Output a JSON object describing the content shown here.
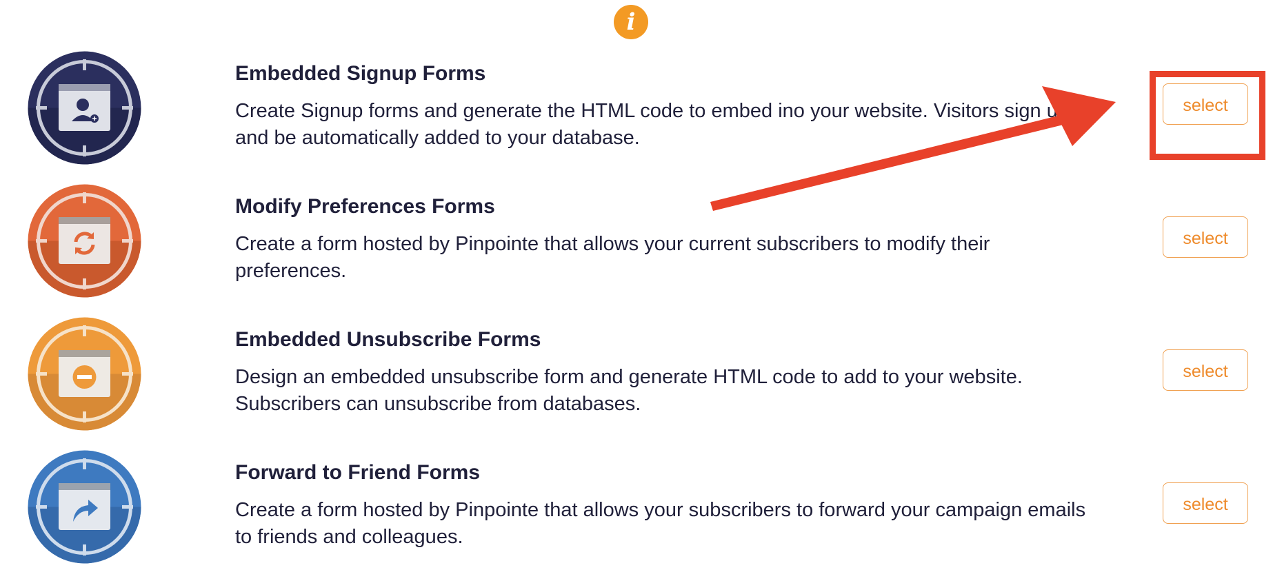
{
  "header": {
    "info_icon": "info-icon"
  },
  "forms": [
    {
      "title": "Embedded Signup Forms",
      "description": "Create Signup forms and generate the HTML code to embed ino your website. Visitors sign up and be automatically added to your database.",
      "icon": "add-user-icon",
      "color": "#2b2f5e",
      "button_label": "select"
    },
    {
      "title": "Modify Preferences Forms",
      "description": "Create a form hosted by Pinpointe that allows your current subscribers to modify their preferences.",
      "icon": "refresh-icon",
      "color": "#e2683a",
      "button_label": "select"
    },
    {
      "title": "Embedded Unsubscribe Forms",
      "description": "Design an embedded unsubscribe form and generate HTML code to add to your website. Subscribers can unsubscribe from databases.",
      "icon": "minus-circle-icon",
      "color": "#ee9a3a",
      "button_label": "select"
    },
    {
      "title": "Forward to Friend Forms",
      "description": "Create a form hosted by Pinpointe that allows your subscribers to forward your campaign emails to friends and colleagues.",
      "icon": "share-arrow-icon",
      "color": "#3e7ac0",
      "button_label": "select"
    }
  ],
  "annotation": {
    "arrow_color": "#e8412a",
    "highlight_color": "#e8412a"
  }
}
